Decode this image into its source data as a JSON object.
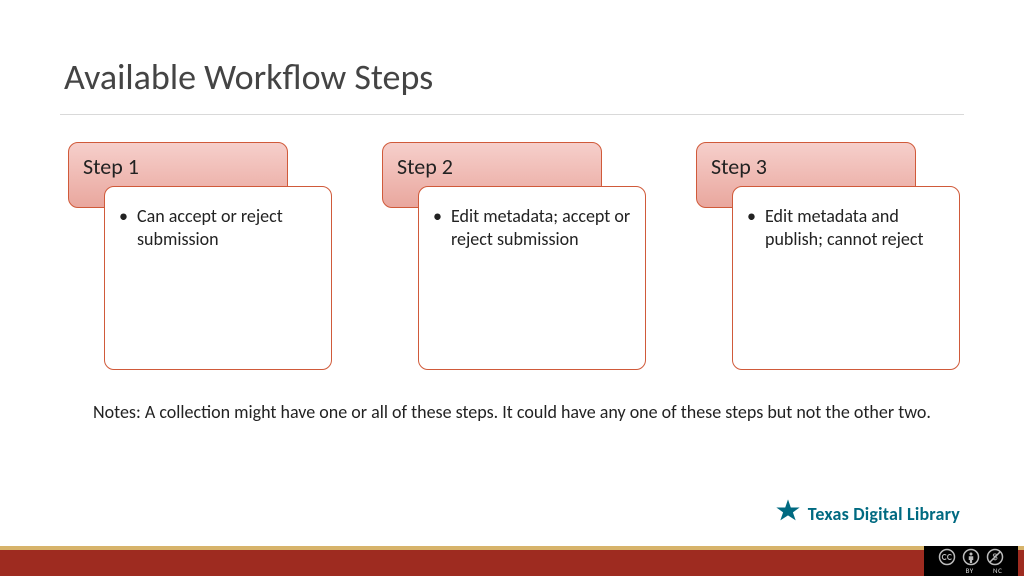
{
  "title": "Available Workflow Steps",
  "steps": [
    {
      "label": "Step 1",
      "desc": "Can accept or reject submission"
    },
    {
      "label": "Step 2",
      "desc": "Edit metadata; accept or reject submission"
    },
    {
      "label": "Step 3",
      "desc": "Edit metadata and publish; cannot reject"
    }
  ],
  "notes": "Notes: A collection might have one or all of these steps. It could have any one of these steps but not the other two.",
  "logo_text": "Texas Digital Library",
  "cc": {
    "by": "BY",
    "nc": "NC"
  },
  "colors": {
    "accent": "#d05a3a",
    "header_grad_top": "#f6cfcb",
    "header_grad_bot": "#e9a79e",
    "band": "#9e2b20",
    "band_trim": "#d7b36a",
    "logo": "#006a81"
  }
}
